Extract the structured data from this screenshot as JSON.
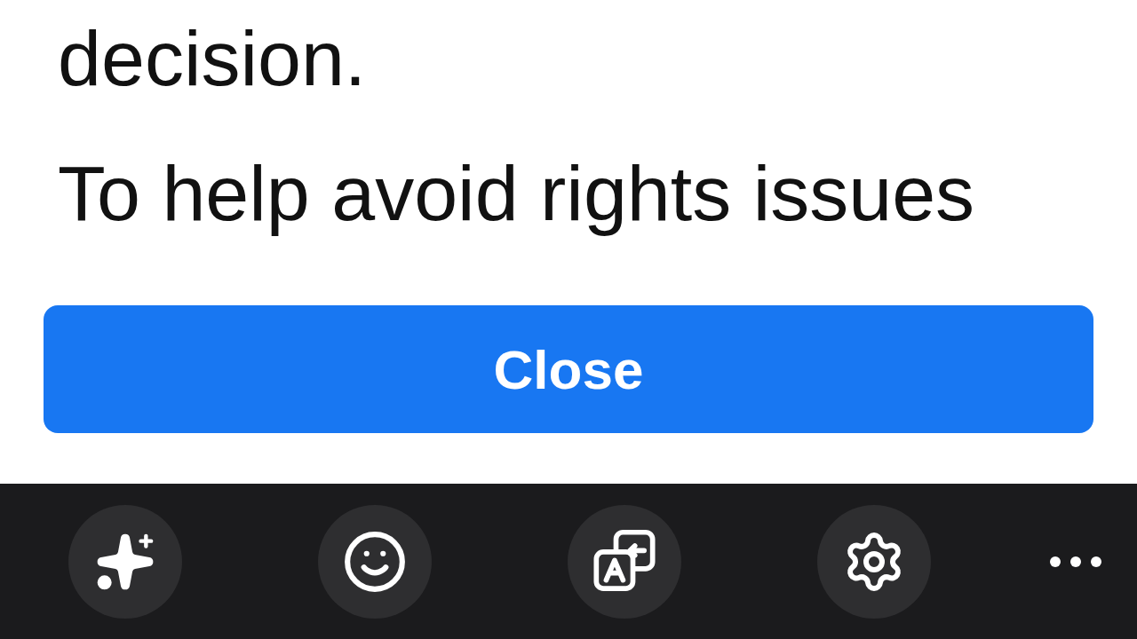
{
  "dialog": {
    "paragraphs": [
      "decision.",
      "To help avoid rights issues"
    ],
    "button": {
      "label": "Close"
    }
  }
}
